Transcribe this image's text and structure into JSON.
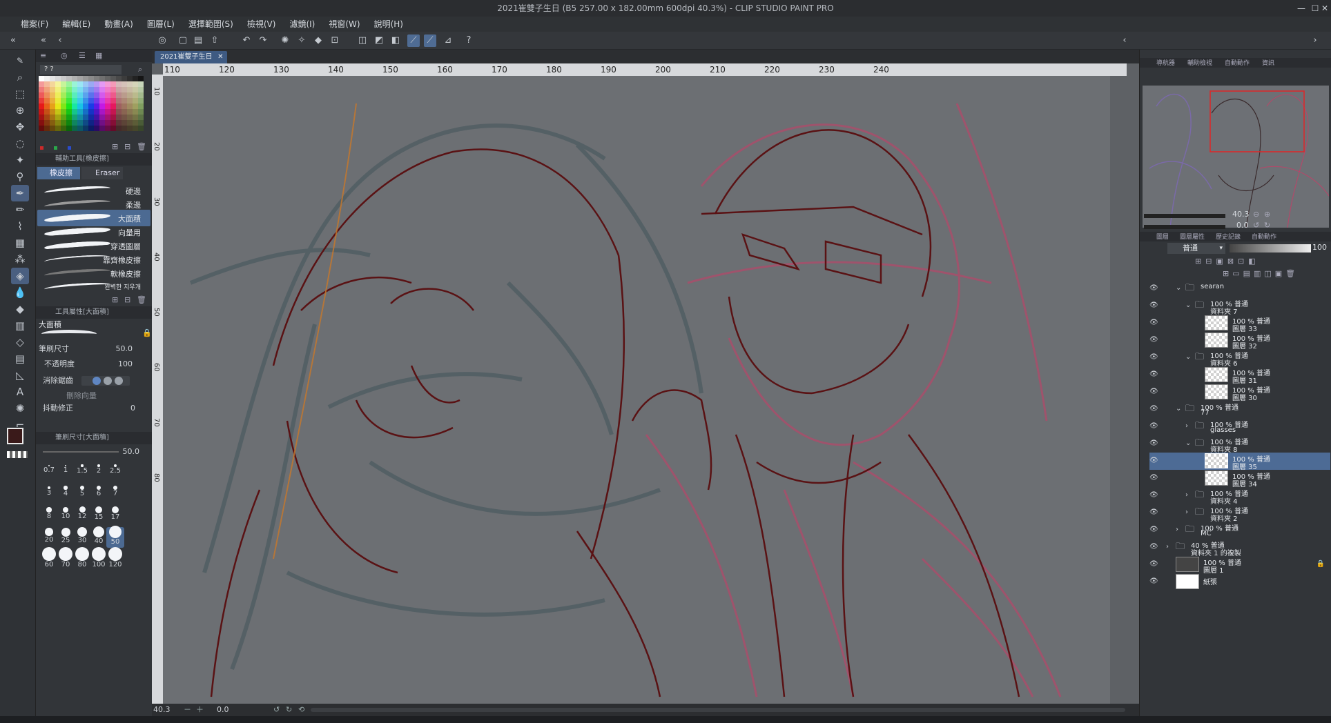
{
  "window": {
    "title": "2021崔雙子生日 (B5 257.00 x 182.00mm 600dpi 40.3%)  - CLIP STUDIO PAINT PRO",
    "controls": [
      "—",
      "☐",
      "✕"
    ]
  },
  "menubar": {
    "items": [
      "檔案(F)",
      "編輯(E)",
      "動畫(A)",
      "圖層(L)",
      "選擇範圍(S)",
      "檢視(V)",
      "濾鏡(I)",
      "視窗(W)",
      "說明(H)"
    ]
  },
  "document_tab": {
    "label": "2021崔雙子生日",
    "close": "✕"
  },
  "rulers": {
    "horizontal": [
      "110",
      "120",
      "130",
      "140",
      "150",
      "160",
      "170",
      "180",
      "190",
      "200",
      "210",
      "220",
      "230",
      "240"
    ],
    "vertical": [
      "10",
      "20",
      "30",
      "40",
      "50",
      "60",
      "70",
      "80"
    ]
  },
  "color_palette": {
    "header": "? ?",
    "mini_colors": [
      "#cc2a2a",
      "#2aa84a",
      "#2a4ccc"
    ]
  },
  "sub_tool_panel": {
    "header": "輔助工具[橡皮擦]",
    "tabs": [
      "橡皮擦",
      "Eraser"
    ],
    "items": [
      {
        "label": "硬邊"
      },
      {
        "label": "柔邊"
      },
      {
        "label": "大面積",
        "selected": true
      },
      {
        "label": "向量用"
      },
      {
        "label": "穿透圖層"
      },
      {
        "label": "靠齊橡皮擦"
      },
      {
        "label": "軟橡皮擦"
      },
      {
        "label": "완벽한 지우개"
      }
    ]
  },
  "tool_property": {
    "header": "工具屬性[大面積]",
    "preset_name": "大面積",
    "brush_size": {
      "label": "筆刷尺寸",
      "value": "50.0"
    },
    "opacity": {
      "label": "不透明度",
      "value": "100"
    },
    "antialias": {
      "label": "消除鋸齒"
    },
    "vector_erase": {
      "label": "刪除向量"
    },
    "stabilization": {
      "label": "抖動修正",
      "value": "0"
    }
  },
  "brush_size_panel": {
    "header": "筆刷尺寸[大面積]",
    "value": "50.0",
    "sizes": [
      "0.7",
      "1",
      "1.5",
      "2",
      "2.5",
      "3",
      "4",
      "5",
      "6",
      "7",
      "8",
      "10",
      "12",
      "15",
      "17",
      "20",
      "25",
      "30",
      "40",
      "50",
      "60",
      "70",
      "80",
      "100",
      "120"
    ],
    "selected_size": "50"
  },
  "canvas_status": {
    "zoom": "40.3",
    "angle": "0.0"
  },
  "navigator": {
    "tabs": [
      "導航器",
      "輔助檢視",
      "自動動作",
      "資訊"
    ],
    "zoom": "40.3",
    "rotation": "0.0"
  },
  "layer_panel": {
    "tabs": [
      "圖層",
      "圖層屬性",
      "歷史記錄",
      "自動動作"
    ],
    "blend_mode": "普通",
    "opacity": "100",
    "layers": [
      {
        "top": "",
        "name": "searan",
        "type": "folder",
        "indent": 1,
        "expanded": true
      },
      {
        "top": "100 % 普通",
        "name": "資料夾 7",
        "type": "folder",
        "indent": 2,
        "expanded": true
      },
      {
        "top": "100 % 普通",
        "name": "圖層 33",
        "type": "raster",
        "indent": 3
      },
      {
        "top": "100 % 普通",
        "name": "圖層 32",
        "type": "raster",
        "indent": 3
      },
      {
        "top": "100 % 普通",
        "name": "資料夾 6",
        "type": "folder",
        "indent": 2,
        "expanded": true
      },
      {
        "top": "100 % 普通",
        "name": "圖層 31",
        "type": "raster",
        "indent": 3
      },
      {
        "top": "100 % 普通",
        "name": "圖層 30",
        "type": "raster",
        "indent": 3
      },
      {
        "top": "100 % 普通",
        "name": "77",
        "type": "folder",
        "indent": 1,
        "expanded": true
      },
      {
        "top": "100 % 普通",
        "name": "glasses",
        "type": "folder",
        "indent": 2,
        "expanded": false
      },
      {
        "top": "100 % 普通",
        "name": "資料夾 8",
        "type": "folder",
        "indent": 2,
        "expanded": true
      },
      {
        "top": "100 % 普通",
        "name": "圖層 35",
        "type": "raster",
        "indent": 3,
        "selected": true
      },
      {
        "top": "100 % 普通",
        "name": "圖層 34",
        "type": "raster",
        "indent": 3
      },
      {
        "top": "100 % 普通",
        "name": "資料夾 4",
        "type": "folder",
        "indent": 2,
        "expanded": false
      },
      {
        "top": "100 % 普通",
        "name": "資料夾 2",
        "type": "folder",
        "indent": 2,
        "expanded": false
      },
      {
        "top": "100 % 普通",
        "name": "MC",
        "type": "folder",
        "indent": 1,
        "expanded": false
      },
      {
        "top": "40 % 普通",
        "name": "資料夾 1 的複製",
        "type": "folder",
        "indent": 0,
        "expanded": false
      },
      {
        "top": "100 % 普通",
        "name": "圖層 1",
        "type": "raster-dark",
        "indent": 0,
        "locked": true
      },
      {
        "top": "",
        "name": "紙張",
        "type": "paper",
        "indent": 0
      }
    ]
  }
}
